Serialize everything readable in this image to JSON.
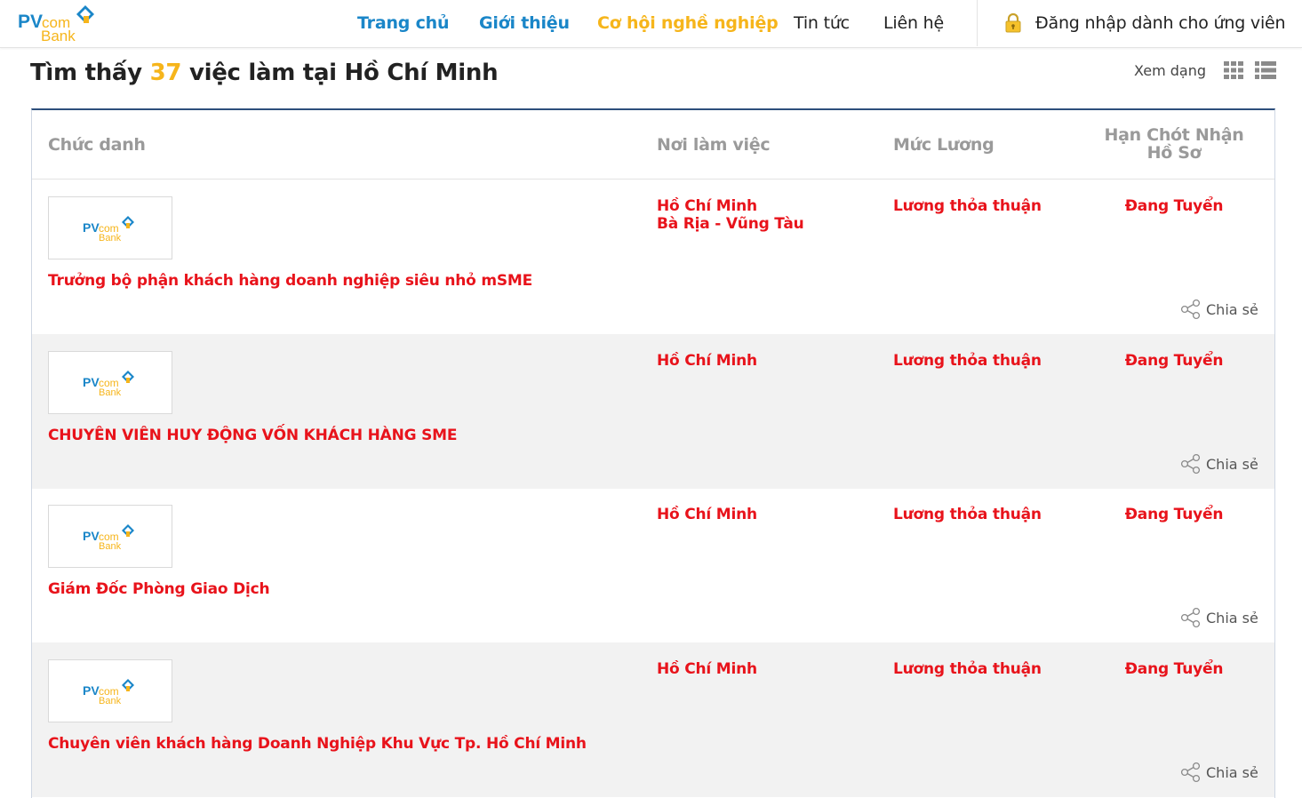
{
  "header": {
    "logo": {
      "line1_pv": "PV",
      "line1_com": "com",
      "line2": "Bank"
    },
    "nav": {
      "home": "Trang chủ",
      "about": "Giới thiệu",
      "career": "Cơ hội nghề nghiệp",
      "news": "Tin tức",
      "contact": "Liên hệ"
    },
    "login": "Đăng nhập dành cho ứng viên"
  },
  "results": {
    "prefix": "Tìm thấy",
    "count": "37",
    "suffix": "việc làm tại Hồ Chí Minh",
    "view_label": "Xem dạng"
  },
  "table": {
    "headers": {
      "title": "Chức danh",
      "place": "Nơi làm việc",
      "salary": "Mức Lương",
      "deadline_line1": "Hạn Chót Nhận",
      "deadline_line2": "Hồ Sơ"
    },
    "share_label": "Chia sẻ",
    "rows": [
      {
        "title": "Trưởng bộ phận khách hàng doanh nghiệp siêu nhỏ mSME",
        "place_line1": "Hồ Chí Minh",
        "place_line2": "Bà Rịa - Vũng Tàu",
        "salary": "Lương thỏa thuận",
        "status": "Đang Tuyển"
      },
      {
        "title": "CHUYÊN VIÊN HUY ĐỘNG VỐN KHÁCH HÀNG SME",
        "place_line1": "Hồ Chí Minh",
        "place_line2": "",
        "salary": "Lương thỏa thuận",
        "status": "Đang Tuyển"
      },
      {
        "title": "Giám Đốc Phòng Giao Dịch",
        "place_line1": "Hồ Chí Minh",
        "place_line2": "",
        "salary": "Lương thỏa thuận",
        "status": "Đang Tuyển"
      },
      {
        "title": "Chuyên viên khách hàng Doanh Nghiệp Khu Vực Tp. Hồ Chí Minh",
        "place_line1": "Hồ Chí Minh",
        "place_line2": "",
        "salary": "Lương thỏa thuận",
        "status": "Đang Tuyển"
      }
    ]
  },
  "colors": {
    "brand_blue": "#1a86c8",
    "brand_yellow": "#f6b51b",
    "job_red": "#e8131b",
    "header_gray": "#9a9a9a",
    "row_alt_bg": "#f2f2f2",
    "table_top_border": "#2d4f7c"
  },
  "icons": {
    "logo": "pvcombank-logo",
    "lock": "lock-icon",
    "grid_view": "grid-view-icon",
    "list_view": "list-view-icon",
    "share": "share-icon"
  }
}
